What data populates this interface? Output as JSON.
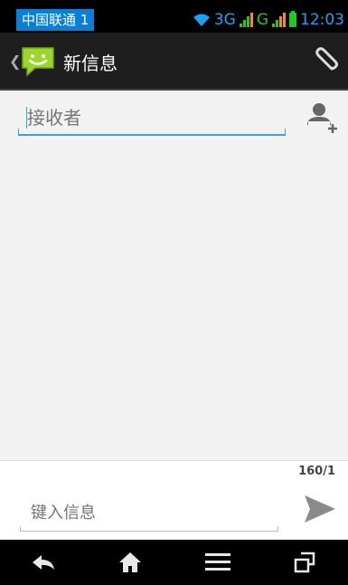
{
  "status_bar": {
    "carrier": "中国联通 1",
    "network_label": "3G",
    "network2_label": "G",
    "time": "12:03",
    "icons": [
      "wifi-icon",
      "signal-icon",
      "battery-icon"
    ]
  },
  "action_bar": {
    "title": "新信息",
    "icons": [
      "back-chevron-icon",
      "messaging-app-icon",
      "paperclip-icon"
    ]
  },
  "recipient": {
    "placeholder": "接收者",
    "value": ""
  },
  "compose": {
    "char_counter": "160/1",
    "placeholder": "键入信息",
    "value": ""
  },
  "nav_bar": {
    "icons": [
      "back-icon",
      "home-icon",
      "menu-icon",
      "recent-apps-icon"
    ]
  },
  "colors": {
    "accent": "#33a5e6",
    "carrier_bg": "#0a7fd6",
    "signal_green": "#23c823",
    "action_bar_bg": "#1e1e1e",
    "content_bg": "#f2f2f2"
  }
}
